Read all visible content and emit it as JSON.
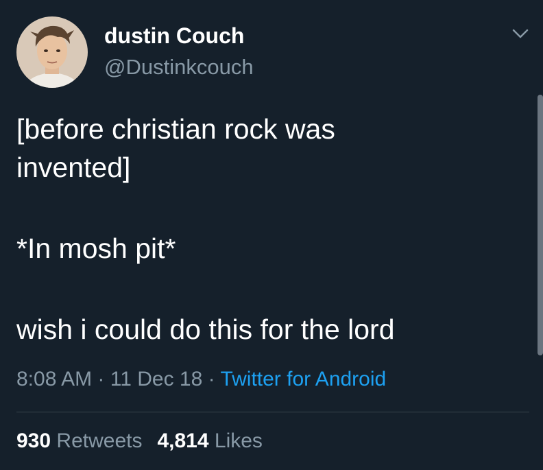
{
  "user": {
    "display_name": "dustin Couch",
    "handle": "@Dustinkcouch"
  },
  "tweet": {
    "lines": [
      "[before christian rock was\ninvented]",
      "*In mosh pit*",
      "wish i could do this for the lord"
    ],
    "time": "8:08 AM",
    "date": "11 Dec 18",
    "separator": "·",
    "source": "Twitter for Android"
  },
  "stats": {
    "retweets_count": "930",
    "retweets_label": "Retweets",
    "likes_count": "4,814",
    "likes_label": "Likes"
  },
  "colors": {
    "background": "#15202b",
    "text_primary": "#ffffff",
    "text_secondary": "#8899a6",
    "link": "#1da1f2",
    "divider": "#38444d"
  },
  "icons": {
    "menu": "chevron-down-icon",
    "avatar": "avatar"
  }
}
